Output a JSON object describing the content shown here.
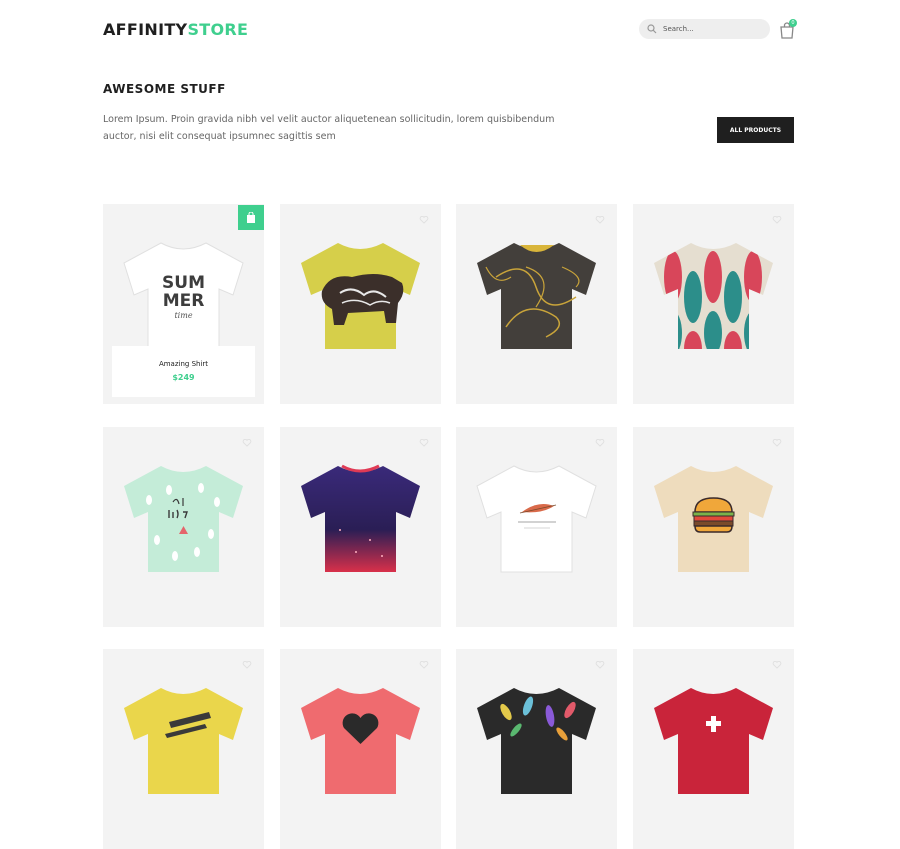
{
  "header": {
    "logo_part1": "AFFINITY",
    "logo_part2": "STORE",
    "search_placeholder": "Search...",
    "cart_count": "0",
    "icons": [
      "search-icon",
      "shopping-bag-icon"
    ]
  },
  "intro": {
    "title": "AWESOME STUFF",
    "description": "Lorem Ipsum. Proin gravida nibh vel velit auctor aliquetenean sollicitudin, lorem quisbibendum auctor, nisi elit consequat ipsumnec sagittis sem",
    "button_label": "ALL PRODUCTS"
  },
  "colors": {
    "accent": "#3fcf8e",
    "dark": "#1f1f1f",
    "card_bg": "#f3f3f3"
  },
  "featured": {
    "name": "Amazing Shirt",
    "price": "$249",
    "print_line1": "SUM",
    "print_line2": "MER",
    "print_line3": "time"
  },
  "products": [
    {
      "shirt": "#ffffff",
      "design": "summer"
    },
    {
      "shirt": "#d6cf4a",
      "design": "bear"
    },
    {
      "shirt": "#433f3b",
      "design": "swirl"
    },
    {
      "shirt": "#d9d2c4",
      "design": "pattern"
    },
    {
      "shirt": "#c4ecd8",
      "design": "real-life"
    },
    {
      "shirt": "#3d2a6e",
      "design": "galaxy"
    },
    {
      "shirt": "#ffffff",
      "design": "feather"
    },
    {
      "shirt": "#eedcbd",
      "design": "burger"
    },
    {
      "shirt": "#ead64b",
      "design": "text"
    },
    {
      "shirt": "#ef6b6f",
      "design": "heart"
    },
    {
      "shirt": "#2a2a2a",
      "design": "floral"
    },
    {
      "shirt": "#c9243a",
      "design": "cross"
    }
  ]
}
